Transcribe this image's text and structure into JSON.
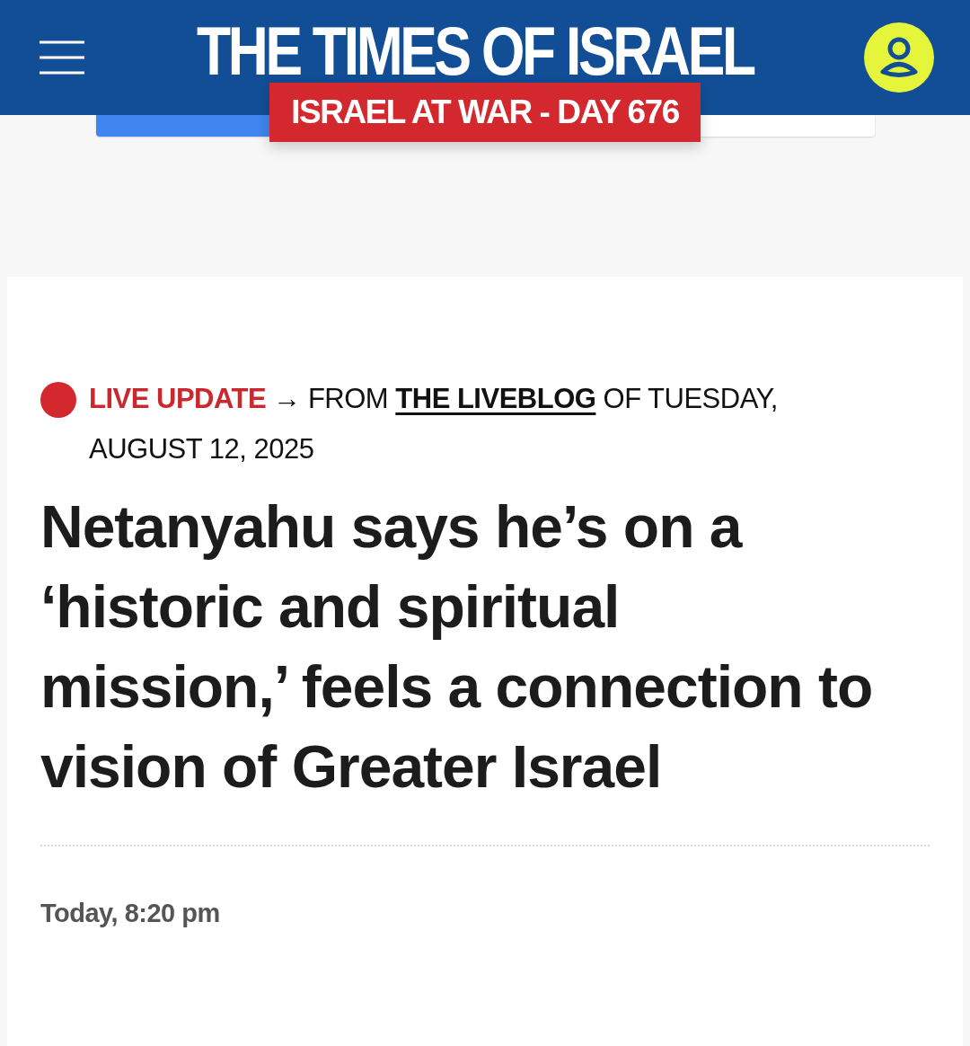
{
  "header": {
    "title": "THE TIMES OF ISRAEL",
    "banner": "ISRAEL AT WAR - DAY 676"
  },
  "article": {
    "live_label": "LIVE UPDATE",
    "arrow": "→",
    "from": "FROM",
    "link": "THE LIVEBLOG",
    "date": "OF TUESDAY, AUGUST 12, 2025",
    "headline": "Netanyahu says he’s on a ‘historic and spiritual mission,’ feels a connection to vision of Greater Israel",
    "time": "Today, 8:20 pm"
  }
}
